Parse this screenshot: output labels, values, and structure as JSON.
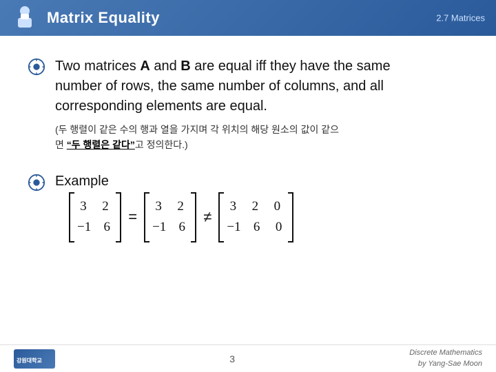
{
  "header": {
    "title": "Matrix Equality",
    "subtitle": "2.7 Matrices",
    "logo_alt": "university-logo"
  },
  "content": {
    "main_text_part1": "Two matrices ",
    "main_text_A": "A",
    "main_text_and": " and ",
    "main_text_B": "B",
    "main_text_part2": " are equal iff they have the same",
    "main_text_line2": "number of rows, the same number of columns, and all",
    "main_text_line3": "corresponding elements are equal.",
    "korean_line1": "(두 행렬이 같은 수의 행과 열을 가지며 각 위치의 해당 원소의 값이 같으",
    "korean_line2_prefix": "면 ",
    "korean_bold": "“두 행렬은 같다”",
    "korean_line2_suffix": "고 정의한다.)",
    "example_label": "Example",
    "equal_sign": "=",
    "not_equal_sign": "≠",
    "matrix1": {
      "rows": [
        [
          "3",
          "2"
        ],
        [
          "-1",
          "6"
        ]
      ]
    },
    "matrix2": {
      "rows": [
        [
          "3",
          "2"
        ],
        [
          "-1",
          "6"
        ]
      ]
    },
    "matrix3": {
      "rows": [
        [
          "3",
          "2",
          "0"
        ],
        [
          "-1",
          "6",
          "0"
        ]
      ]
    }
  },
  "footer": {
    "page_number": "3",
    "credit_line1": "Discrete Mathematics",
    "credit_line2": "by Yang-Sae Moon"
  }
}
